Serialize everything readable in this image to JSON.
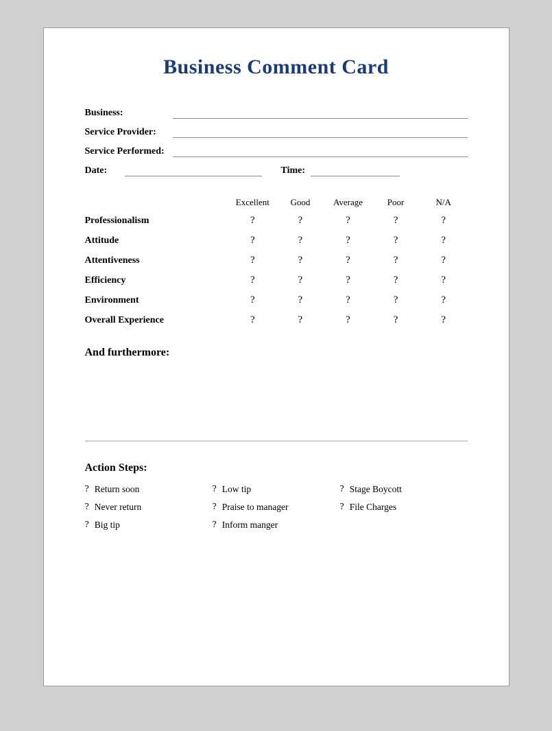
{
  "card": {
    "title": "Business Comment Card",
    "fields": {
      "business_label": "Business:",
      "service_provider_label": "Service Provider:",
      "service_performed_label": "Service Performed:",
      "date_label": "Date:",
      "time_label": "Time:"
    },
    "rating": {
      "headers": [
        "Excellent",
        "Good",
        "Average",
        "Poor",
        "N/A"
      ],
      "mark": "?",
      "rows": [
        "Professionalism",
        "Attitude",
        "Attentiveness",
        "Efficiency",
        "Environment",
        "Overall Experience"
      ]
    },
    "furthermore": {
      "title": "And furthermore:"
    },
    "action_steps": {
      "title": "Action Steps:",
      "items": [
        [
          "Return soon",
          "Low tip",
          "Stage Boycott"
        ],
        [
          "Never return",
          "Praise to manager",
          "File Charges"
        ],
        [
          "Big tip",
          "Inform manger",
          ""
        ]
      ]
    }
  }
}
